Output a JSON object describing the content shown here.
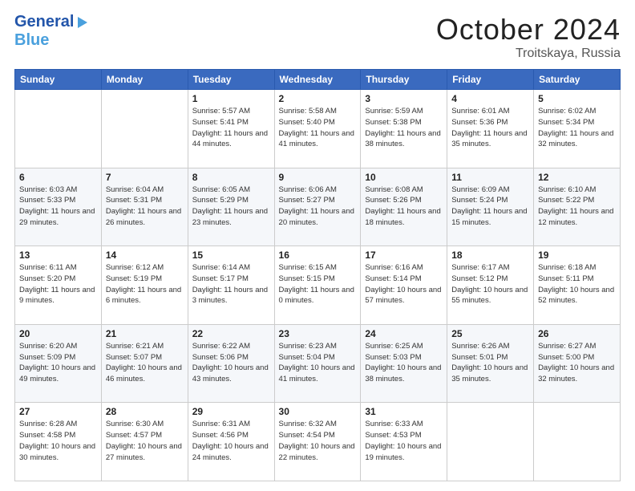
{
  "header": {
    "logo_general": "General",
    "logo_blue": "Blue",
    "month": "October 2024",
    "location": "Troitskaya, Russia"
  },
  "columns": [
    "Sunday",
    "Monday",
    "Tuesday",
    "Wednesday",
    "Thursday",
    "Friday",
    "Saturday"
  ],
  "weeks": [
    [
      {
        "day": "",
        "info": ""
      },
      {
        "day": "",
        "info": ""
      },
      {
        "day": "1",
        "info": "Sunrise: 5:57 AM\nSunset: 5:41 PM\nDaylight: 11 hours and 44 minutes."
      },
      {
        "day": "2",
        "info": "Sunrise: 5:58 AM\nSunset: 5:40 PM\nDaylight: 11 hours and 41 minutes."
      },
      {
        "day": "3",
        "info": "Sunrise: 5:59 AM\nSunset: 5:38 PM\nDaylight: 11 hours and 38 minutes."
      },
      {
        "day": "4",
        "info": "Sunrise: 6:01 AM\nSunset: 5:36 PM\nDaylight: 11 hours and 35 minutes."
      },
      {
        "day": "5",
        "info": "Sunrise: 6:02 AM\nSunset: 5:34 PM\nDaylight: 11 hours and 32 minutes."
      }
    ],
    [
      {
        "day": "6",
        "info": "Sunrise: 6:03 AM\nSunset: 5:33 PM\nDaylight: 11 hours and 29 minutes."
      },
      {
        "day": "7",
        "info": "Sunrise: 6:04 AM\nSunset: 5:31 PM\nDaylight: 11 hours and 26 minutes."
      },
      {
        "day": "8",
        "info": "Sunrise: 6:05 AM\nSunset: 5:29 PM\nDaylight: 11 hours and 23 minutes."
      },
      {
        "day": "9",
        "info": "Sunrise: 6:06 AM\nSunset: 5:27 PM\nDaylight: 11 hours and 20 minutes."
      },
      {
        "day": "10",
        "info": "Sunrise: 6:08 AM\nSunset: 5:26 PM\nDaylight: 11 hours and 18 minutes."
      },
      {
        "day": "11",
        "info": "Sunrise: 6:09 AM\nSunset: 5:24 PM\nDaylight: 11 hours and 15 minutes."
      },
      {
        "day": "12",
        "info": "Sunrise: 6:10 AM\nSunset: 5:22 PM\nDaylight: 11 hours and 12 minutes."
      }
    ],
    [
      {
        "day": "13",
        "info": "Sunrise: 6:11 AM\nSunset: 5:20 PM\nDaylight: 11 hours and 9 minutes."
      },
      {
        "day": "14",
        "info": "Sunrise: 6:12 AM\nSunset: 5:19 PM\nDaylight: 11 hours and 6 minutes."
      },
      {
        "day": "15",
        "info": "Sunrise: 6:14 AM\nSunset: 5:17 PM\nDaylight: 11 hours and 3 minutes."
      },
      {
        "day": "16",
        "info": "Sunrise: 6:15 AM\nSunset: 5:15 PM\nDaylight: 11 hours and 0 minutes."
      },
      {
        "day": "17",
        "info": "Sunrise: 6:16 AM\nSunset: 5:14 PM\nDaylight: 10 hours and 57 minutes."
      },
      {
        "day": "18",
        "info": "Sunrise: 6:17 AM\nSunset: 5:12 PM\nDaylight: 10 hours and 55 minutes."
      },
      {
        "day": "19",
        "info": "Sunrise: 6:18 AM\nSunset: 5:11 PM\nDaylight: 10 hours and 52 minutes."
      }
    ],
    [
      {
        "day": "20",
        "info": "Sunrise: 6:20 AM\nSunset: 5:09 PM\nDaylight: 10 hours and 49 minutes."
      },
      {
        "day": "21",
        "info": "Sunrise: 6:21 AM\nSunset: 5:07 PM\nDaylight: 10 hours and 46 minutes."
      },
      {
        "day": "22",
        "info": "Sunrise: 6:22 AM\nSunset: 5:06 PM\nDaylight: 10 hours and 43 minutes."
      },
      {
        "day": "23",
        "info": "Sunrise: 6:23 AM\nSunset: 5:04 PM\nDaylight: 10 hours and 41 minutes."
      },
      {
        "day": "24",
        "info": "Sunrise: 6:25 AM\nSunset: 5:03 PM\nDaylight: 10 hours and 38 minutes."
      },
      {
        "day": "25",
        "info": "Sunrise: 6:26 AM\nSunset: 5:01 PM\nDaylight: 10 hours and 35 minutes."
      },
      {
        "day": "26",
        "info": "Sunrise: 6:27 AM\nSunset: 5:00 PM\nDaylight: 10 hours and 32 minutes."
      }
    ],
    [
      {
        "day": "27",
        "info": "Sunrise: 6:28 AM\nSunset: 4:58 PM\nDaylight: 10 hours and 30 minutes."
      },
      {
        "day": "28",
        "info": "Sunrise: 6:30 AM\nSunset: 4:57 PM\nDaylight: 10 hours and 27 minutes."
      },
      {
        "day": "29",
        "info": "Sunrise: 6:31 AM\nSunset: 4:56 PM\nDaylight: 10 hours and 24 minutes."
      },
      {
        "day": "30",
        "info": "Sunrise: 6:32 AM\nSunset: 4:54 PM\nDaylight: 10 hours and 22 minutes."
      },
      {
        "day": "31",
        "info": "Sunrise: 6:33 AM\nSunset: 4:53 PM\nDaylight: 10 hours and 19 minutes."
      },
      {
        "day": "",
        "info": ""
      },
      {
        "day": "",
        "info": ""
      }
    ]
  ]
}
